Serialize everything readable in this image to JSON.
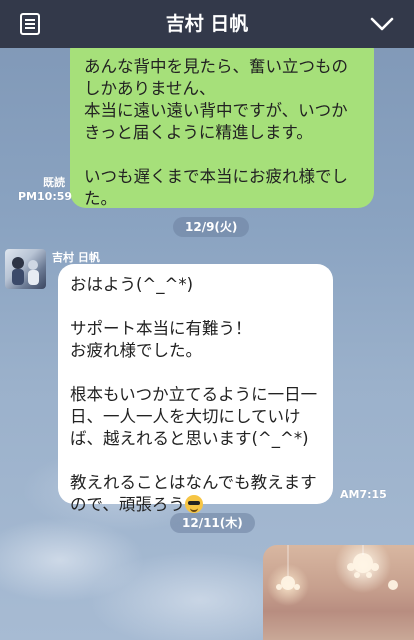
{
  "header": {
    "title": "吉村 日帆",
    "menu_icon": "list-icon",
    "toggle_icon": "chevron-down-icon"
  },
  "messages": {
    "outgoing_1": {
      "text": "あんな背中を見たら、奮い立つものしかありません、\n本当に遠い遠い背中ですが、いつかきっと届くように精進します。\n\nいつも遅くまで本当にお疲れ様でした。",
      "read_label": "既読",
      "time": "PM10:59"
    },
    "date_1": "12/9(火)",
    "incoming_1": {
      "sender": "吉村 日帆",
      "text_main": "おはよう(^_^*)\n\nサポート本当に有難う！\nお疲れ様でした。\n\n根本もいつか立てるように一日一日、一人一人を大切にしていけば、越えれると思います(^_^*)\n\n教えれることはなんでも教えますので、頑張ろう",
      "emoji": "smiling-face-with-sunglasses-icon",
      "time": "AM7:15"
    },
    "date_2": "12/11(木)",
    "outgoing_2": {
      "type": "photo"
    }
  },
  "colors": {
    "header_bg": "#33394a",
    "outgoing_bubble": "#a6e07a",
    "incoming_bubble": "#ffffff",
    "background": "#8aa3c1"
  }
}
